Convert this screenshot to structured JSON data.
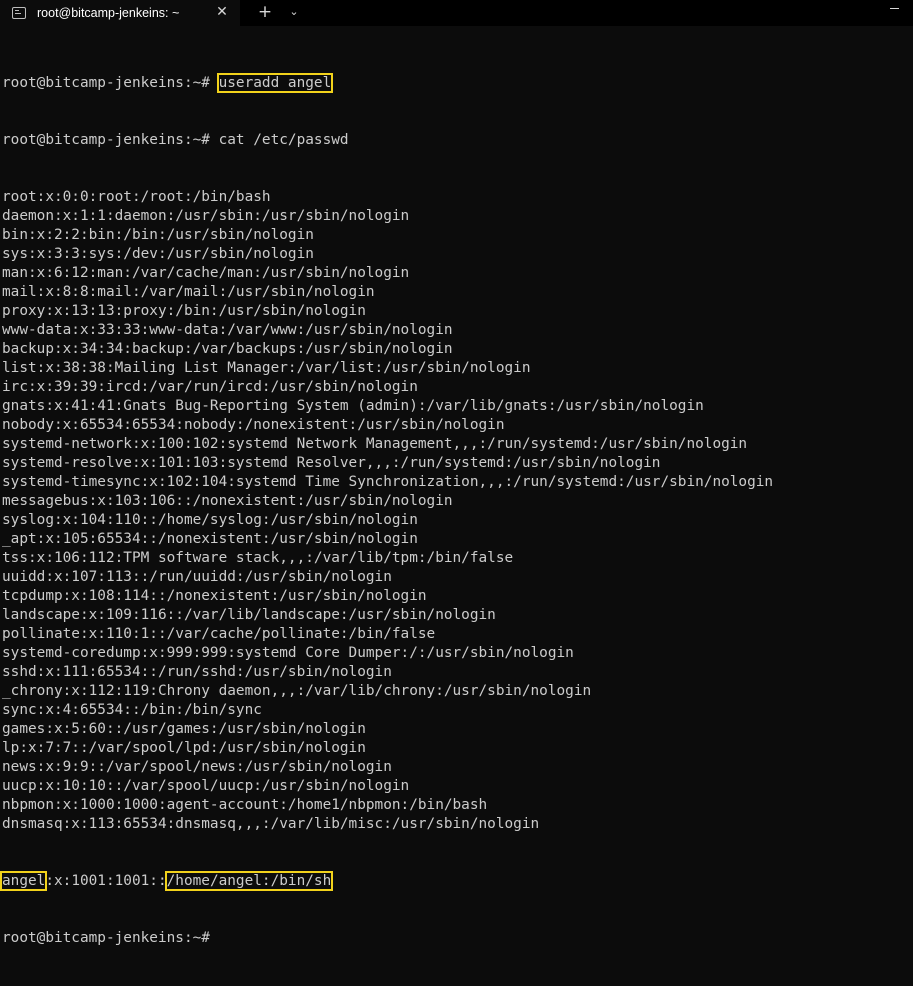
{
  "window": {
    "tab_title": "root@bitcamp-jenkeins: ~",
    "tab_close": "✕",
    "new_tab": "+",
    "dropdown": "⌄"
  },
  "terminal": {
    "prompt": "root@bitcamp-jenkeins:~#",
    "cmd1": "useradd angel",
    "cmd2": "cat /etc/passwd",
    "passwd_lines": [
      "root:x:0:0:root:/root:/bin/bash",
      "daemon:x:1:1:daemon:/usr/sbin:/usr/sbin/nologin",
      "bin:x:2:2:bin:/bin:/usr/sbin/nologin",
      "sys:x:3:3:sys:/dev:/usr/sbin/nologin",
      "man:x:6:12:man:/var/cache/man:/usr/sbin/nologin",
      "mail:x:8:8:mail:/var/mail:/usr/sbin/nologin",
      "proxy:x:13:13:proxy:/bin:/usr/sbin/nologin",
      "www-data:x:33:33:www-data:/var/www:/usr/sbin/nologin",
      "backup:x:34:34:backup:/var/backups:/usr/sbin/nologin",
      "list:x:38:38:Mailing List Manager:/var/list:/usr/sbin/nologin",
      "irc:x:39:39:ircd:/var/run/ircd:/usr/sbin/nologin",
      "gnats:x:41:41:Gnats Bug-Reporting System (admin):/var/lib/gnats:/usr/sbin/nologin",
      "nobody:x:65534:65534:nobody:/nonexistent:/usr/sbin/nologin",
      "systemd-network:x:100:102:systemd Network Management,,,:/run/systemd:/usr/sbin/nologin",
      "systemd-resolve:x:101:103:systemd Resolver,,,:/run/systemd:/usr/sbin/nologin",
      "systemd-timesync:x:102:104:systemd Time Synchronization,,,:/run/systemd:/usr/sbin/nologin",
      "messagebus:x:103:106::/nonexistent:/usr/sbin/nologin",
      "syslog:x:104:110::/home/syslog:/usr/sbin/nologin",
      "_apt:x:105:65534::/nonexistent:/usr/sbin/nologin",
      "tss:x:106:112:TPM software stack,,,:/var/lib/tpm:/bin/false",
      "uuidd:x:107:113::/run/uuidd:/usr/sbin/nologin",
      "tcpdump:x:108:114::/nonexistent:/usr/sbin/nologin",
      "landscape:x:109:116::/var/lib/landscape:/usr/sbin/nologin",
      "pollinate:x:110:1::/var/cache/pollinate:/bin/false",
      "systemd-coredump:x:999:999:systemd Core Dumper:/:/usr/sbin/nologin",
      "sshd:x:111:65534::/run/sshd:/usr/sbin/nologin",
      "_chrony:x:112:119:Chrony daemon,,,:/var/lib/chrony:/usr/sbin/nologin",
      "sync:x:4:65534::/bin:/bin/sync",
      "games:x:5:60::/usr/games:/usr/sbin/nologin",
      "lp:x:7:7::/var/spool/lpd:/usr/sbin/nologin",
      "news:x:9:9::/var/spool/news:/usr/sbin/nologin",
      "uucp:x:10:10::/var/spool/uucp:/usr/sbin/nologin",
      "nbpmon:x:1000:1000:agent-account:/home1/nbpmon:/bin/bash",
      "dnsmasq:x:113:65534:dnsmasq,,,:/var/lib/misc:/usr/sbin/nologin"
    ],
    "angel_line": {
      "user": "angel",
      "middle": ":x:1001:1001::",
      "tail": "/home/angel:/bin/sh"
    }
  },
  "colors": {
    "background": "#0c0c0c",
    "text": "#cccccc",
    "highlight": "#f2d21b"
  },
  "icons": [
    "terminal-icon",
    "close-icon",
    "plus-icon",
    "chevron-down-icon",
    "minimize-icon"
  ]
}
